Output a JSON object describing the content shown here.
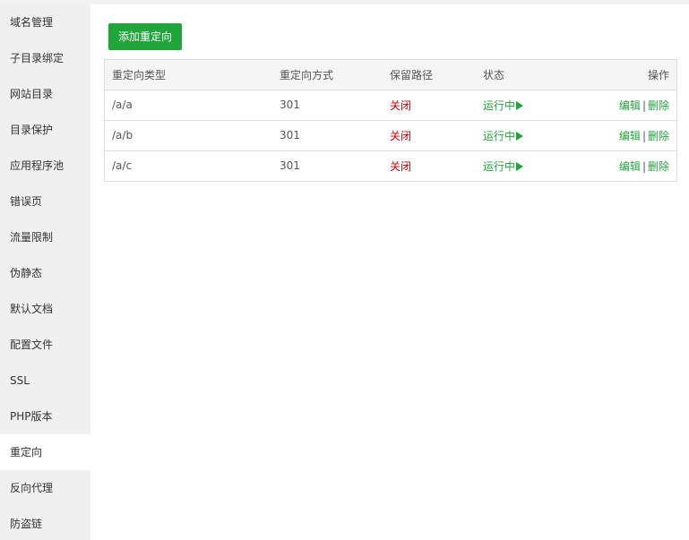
{
  "sidebar": {
    "items": [
      {
        "label": "域名管理"
      },
      {
        "label": "子目录绑定"
      },
      {
        "label": "网站目录"
      },
      {
        "label": "目录保护"
      },
      {
        "label": "应用程序池"
      },
      {
        "label": "错误页"
      },
      {
        "label": "流量限制"
      },
      {
        "label": "伪静态"
      },
      {
        "label": "默认文档"
      },
      {
        "label": "配置文件"
      },
      {
        "label": "SSL"
      },
      {
        "label": "PHP版本"
      },
      {
        "label": "重定向"
      },
      {
        "label": "反向代理"
      },
      {
        "label": "防盗链"
      }
    ],
    "active_index": 12
  },
  "main": {
    "add_button": "添加重定向",
    "table": {
      "headers": [
        "重定向类型",
        "重定向方式",
        "保留路径",
        "状态",
        "操作"
      ],
      "rows": [
        {
          "type": "/a/a",
          "method": "301",
          "keep_path": "关闭",
          "status": "运行中",
          "edit": "编辑",
          "sep": "|",
          "delete": "删除"
        },
        {
          "type": "/a/b",
          "method": "301",
          "keep_path": "关闭",
          "status": "运行中",
          "edit": "编辑",
          "sep": "|",
          "delete": "删除"
        },
        {
          "type": "/a/c",
          "method": "301",
          "keep_path": "关闭",
          "status": "运行中",
          "edit": "编辑",
          "sep": "|",
          "delete": "删除"
        }
      ]
    }
  },
  "colors": {
    "accent": "#20a53a",
    "danger": "#d00000",
    "sidebar_bg": "#f0f0f0"
  },
  "icons": {
    "status": "play-icon"
  }
}
